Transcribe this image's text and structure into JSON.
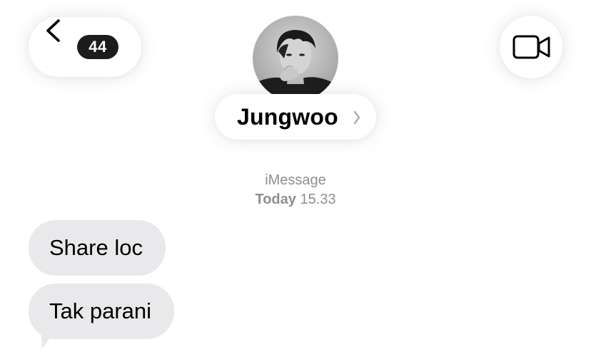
{
  "header": {
    "back_count": "44",
    "contact_name": "Jungwoo"
  },
  "conversation": {
    "service": "iMessage",
    "day": "Today",
    "time": "15.33",
    "messages": [
      {
        "text": "Share loc",
        "direction": "incoming"
      },
      {
        "text": "Tak parani",
        "direction": "incoming"
      }
    ]
  },
  "icons": {
    "back": "chevron-left-icon",
    "video": "video-camera-icon",
    "name_disclosure": "chevron-right-icon"
  },
  "colors": {
    "incoming_bubble": "#e9e9eb",
    "secondary_text": "#8e8e93",
    "badge": "#1c1c1e"
  }
}
